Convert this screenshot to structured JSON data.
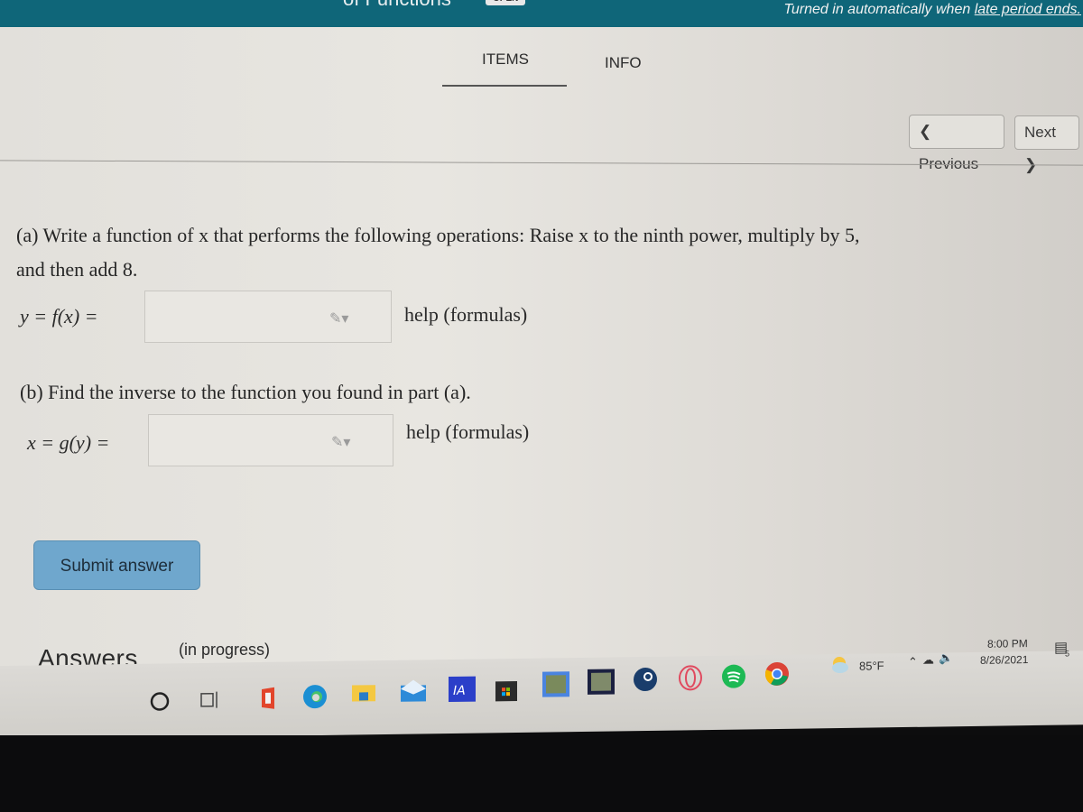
{
  "header": {
    "title_fragment": "of Functions",
    "status_badge": "OPEN",
    "turned_in_prefix": "Turned in automatically when ",
    "turned_in_link": "late period ends."
  },
  "tabs": [
    {
      "label": "ITEMS",
      "active": true
    },
    {
      "label": "INFO",
      "active": false
    }
  ],
  "nav": {
    "previous": "❮ Previous",
    "next": "Next ❯"
  },
  "question": {
    "part_a": {
      "line1": "(a) Write a function of x that performs the following operations: Raise x to the ninth power, multiply by 5,",
      "line2": "and then add 8.",
      "label": "y = f(x) =",
      "value": "",
      "help": "help (formulas)"
    },
    "part_b": {
      "line1": "(b) Find the inverse to the function you found in part (a).",
      "label": "x = g(y) =",
      "value": "",
      "help": "help (formulas)"
    },
    "submit": "Submit answer"
  },
  "answers": {
    "title": "Answers",
    "status": "(in progress)"
  },
  "taskbar": {
    "apps": [
      "search-icon",
      "task-view-icon",
      "office-icon",
      "edge-icon",
      "file-explorer-icon",
      "mail-icon",
      "app-ia-icon",
      "store-icon",
      "photos-icon",
      "game-icon",
      "steam-icon",
      "opera-icon",
      "spotify-icon",
      "chrome-icon"
    ],
    "weather": "85°F",
    "time": "8:00 PM",
    "date": "8/26/2021",
    "notifications": "5"
  },
  "colors": {
    "header_bg": "#0f6679",
    "submit_bg": "#6fa7cd"
  }
}
